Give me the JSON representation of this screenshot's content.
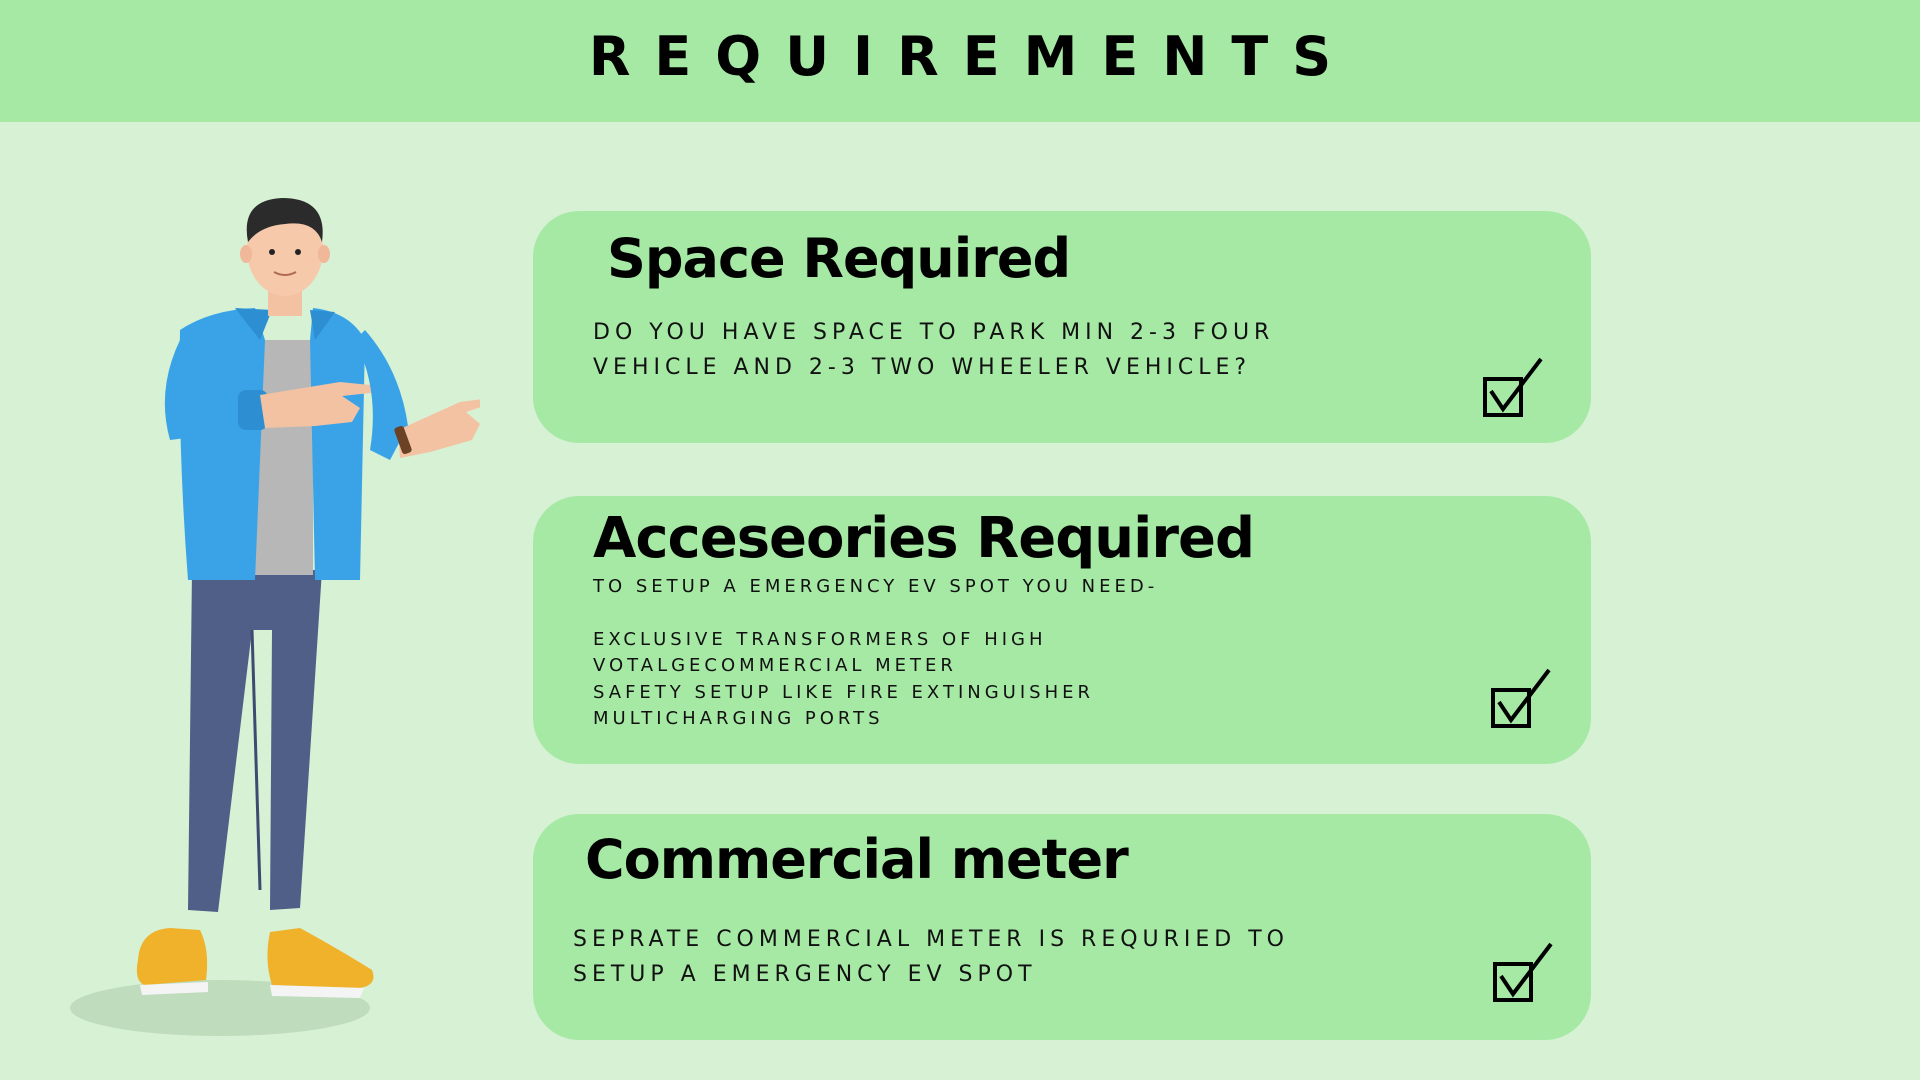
{
  "header": {
    "title": "REQUIREMENTS"
  },
  "cards": [
    {
      "title": "Space Required",
      "lines": [
        "DO YOU HAVE SPACE TO PARK MIN 2-3 FOUR",
        "VEHICLE AND 2-3 TWO WHEELER VEHICLE?"
      ],
      "icon": "checkbox-checked-icon"
    },
    {
      "title": "Acceseories Required",
      "lines": [
        "TO SETUP A EMERGENCY EV SPOT YOU NEED-",
        "",
        "EXCLUSIVE TRANSFORMERS OF HIGH",
        "VOTALGECOMMERCIAL METER",
        "SAFETY SETUP LIKE FIRE EXTINGUISHER",
        "MULTICHARGING PORTS"
      ],
      "icon": "checkbox-checked-icon"
    },
    {
      "title": "Commercial meter",
      "lines": [
        "SEPRATE COMMERCIAL METER IS REQURIED TO",
        "SETUP A EMERGENCY EV SPOT"
      ],
      "icon": "checkbox-checked-icon"
    }
  ],
  "colors": {
    "background": "#d6f1d4",
    "header": "#a6e9a5",
    "card": "#a6e9a5",
    "shirt": "#3aa3e8",
    "pants": "#4f5f88",
    "shoes": "#f0b12b"
  },
  "illustration": {
    "icon": "pointing-man-illustration"
  }
}
